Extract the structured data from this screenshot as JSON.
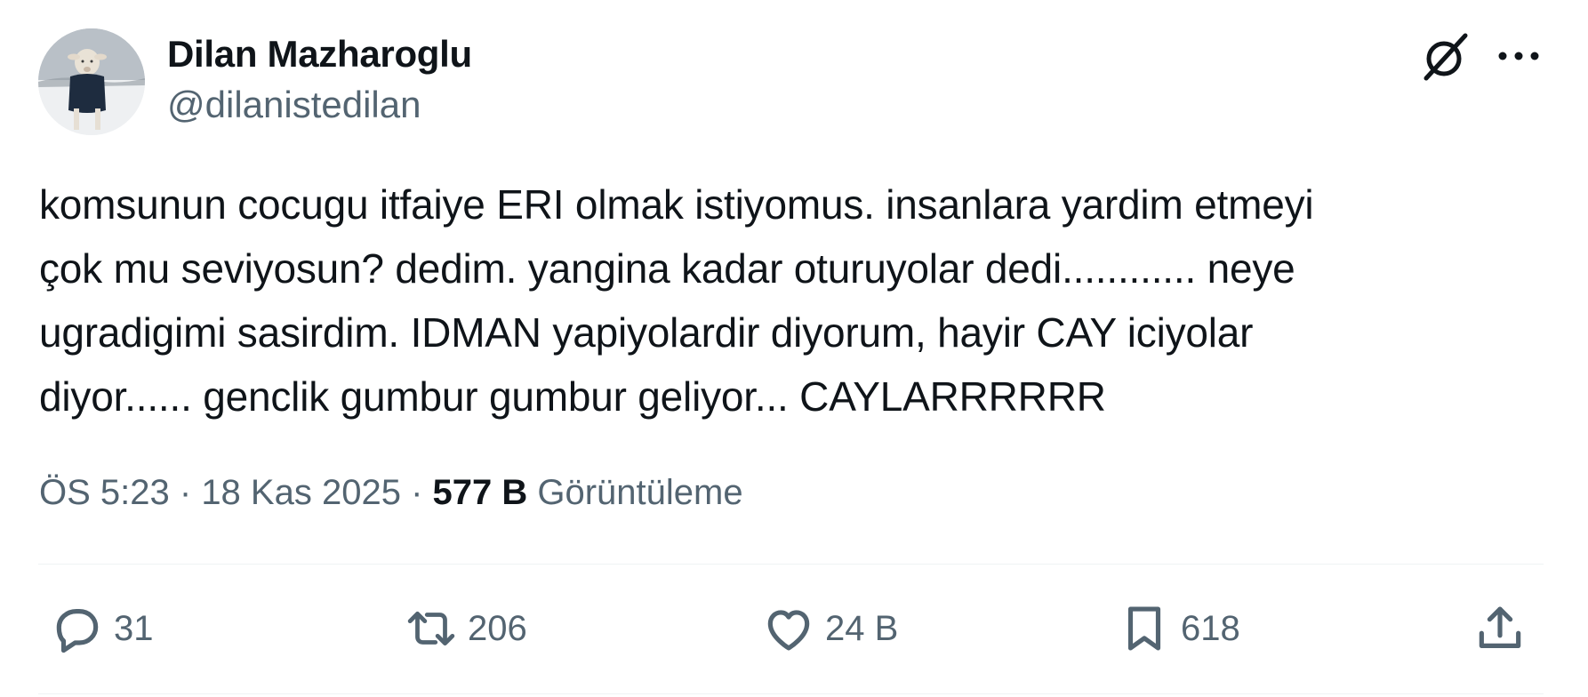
{
  "author": {
    "display_name": "Dilan Mazharoglu",
    "handle": "@dilanistedilan",
    "avatar_icon": "avatar-lamb-in-sweater-snow"
  },
  "header_icons": {
    "grok": "grok-icon",
    "more": "more-dots-icon"
  },
  "tweet": {
    "text": "komsunun cocugu itfaiye ERI olmak istiyomus. insanlara yardim etmeyi\nçok mu seviyosun? dedim. yangina kadar oturuyolar dedi............ neye\nugradigimi sasirdim. IDMAN yapiyolardir diyorum, hayir CAY iciyolar\ndiyor...... genclik gumbur gumbur geliyor... CAYLARRRRRR"
  },
  "meta": {
    "time": "ÖS 5:23",
    "separator": " · ",
    "date": "18 Kas 2025",
    "views_count": "577 B",
    "views_label": "Görüntüleme"
  },
  "actions": {
    "reply": {
      "icon": "reply-icon",
      "count": "31"
    },
    "retweet": {
      "icon": "retweet-icon",
      "count": "206"
    },
    "like": {
      "icon": "heart-icon",
      "count": "24 B"
    },
    "bookmark": {
      "icon": "bookmark-icon",
      "count": "618"
    },
    "share": {
      "icon": "share-icon"
    }
  },
  "colors": {
    "text_primary": "#0f1419",
    "text_secondary": "#536471",
    "divider": "#eff3f4"
  }
}
